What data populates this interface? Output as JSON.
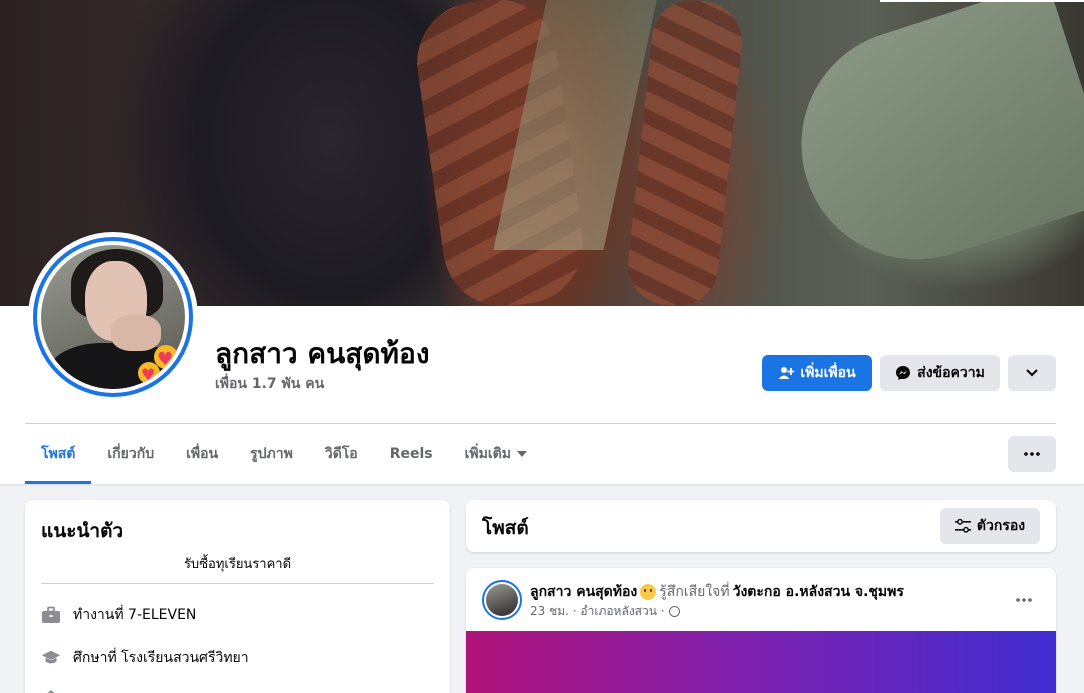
{
  "profile": {
    "name": "ลูกสาว คนสุดท้อง",
    "friends": "เพื่อน 1.7 พัน คน"
  },
  "actions": {
    "add_friend": "เพิ่มเพื่อน",
    "message": "ส่งข้อความ"
  },
  "tabs": [
    {
      "label": "โพสต์",
      "active": true
    },
    {
      "label": "เกี่ยวกับ"
    },
    {
      "label": "เพื่อน"
    },
    {
      "label": "รูปภาพ"
    },
    {
      "label": "วิดีโอ"
    },
    {
      "label": "Reels"
    },
    {
      "label": "เพิ่มเติม"
    }
  ],
  "intro": {
    "title": "แนะนำตัว",
    "bio": "รับซื้อทุเรียนราคาดี",
    "work": "ทำงานที่ 7-ELEVEN",
    "education": "ศึกษาที่ โรงเรียนสวนศรีวิทยา"
  },
  "posts": {
    "title": "โพสต์",
    "filter": "ตัวกรอง"
  },
  "post": {
    "author": "ลูกสาว คนสุดท้อง",
    "feeling": "รู้สึกเสียใจที่",
    "place": "วังตะกอ อ.หลังสวน จ.ชุมพร",
    "meta": "23 ชม. · อำเภอหลังสวน ·"
  },
  "colors": {
    "accent": "#1b74e4",
    "secondary_button": "#e4e6eb",
    "page_bg": "#f0f2f5"
  }
}
